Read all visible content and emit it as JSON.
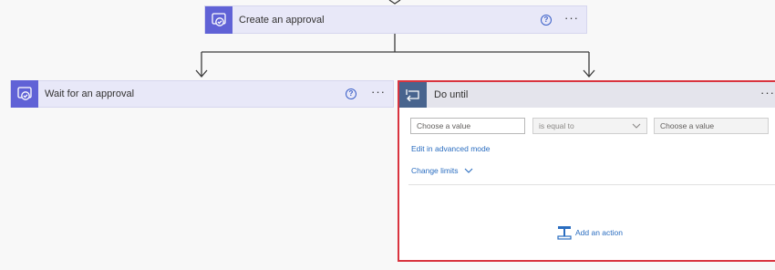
{
  "create_approval": {
    "title": "Create an approval",
    "help_icon": "?",
    "more_icon": "···"
  },
  "wait_approval": {
    "title": "Wait for an approval",
    "help_icon": "?",
    "more_icon": "···"
  },
  "do_until": {
    "title": "Do until",
    "more_icon": "···",
    "condition": {
      "left_placeholder": "Choose a value",
      "operator": "is equal to",
      "right_placeholder": "Choose a value"
    },
    "advanced_mode_link": "Edit in advanced mode",
    "change_limits_link": "Change limits",
    "add_action_link": "Add an action"
  },
  "colors": {
    "approval_accent": "#6062d6",
    "loop_accent": "#48648e",
    "selected_border": "#d9343f",
    "link": "#2a6dc0"
  }
}
